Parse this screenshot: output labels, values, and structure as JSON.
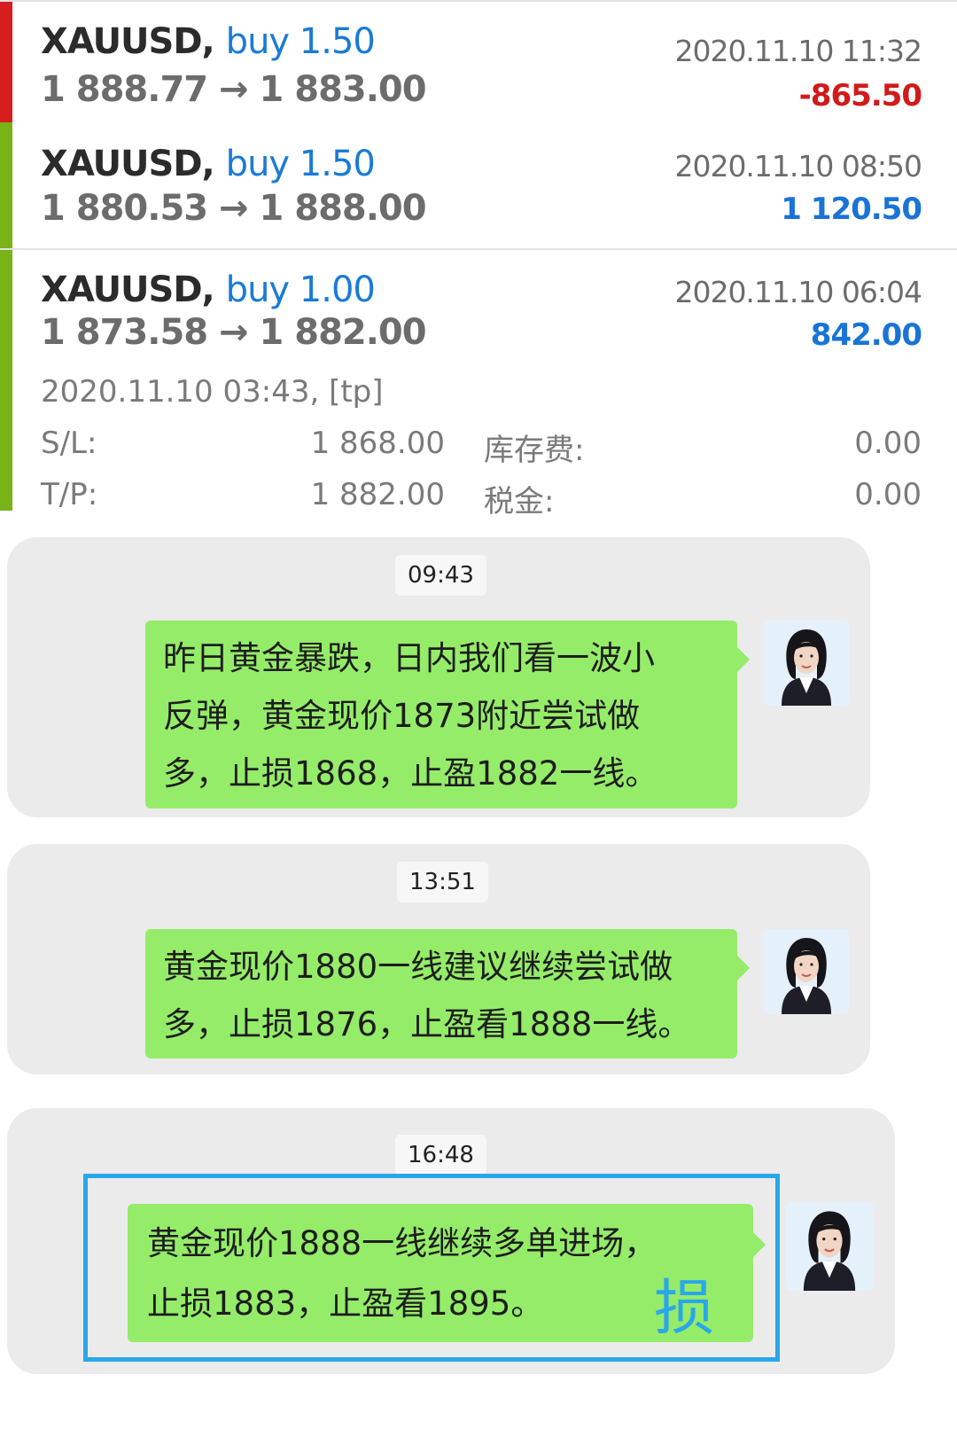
{
  "trades": [
    {
      "symbol": "XAUUSD,",
      "side_volume": "buy 1.50",
      "prices": "1 888.77 → 1 883.00",
      "time": "2020.11.10 11:32",
      "profit": "-865.50",
      "profit_color": "#d11a1a",
      "bar_color": "#d61e1e"
    },
    {
      "symbol": "XAUUSD,",
      "side_volume": "buy 1.50",
      "prices": "1 880.53 → 1 888.00",
      "time": "2020.11.10 08:50",
      "profit": "1 120.50",
      "profit_color": "#1a73d6",
      "bar_color": "#7ab317"
    },
    {
      "symbol": "XAUUSD,",
      "side_volume": "buy 1.00",
      "prices": "1 873.58 → 1 882.00",
      "time": "2020.11.10 06:04",
      "profit": "842.00",
      "profit_color": "#1a73d6",
      "bar_color": "#7ab317",
      "details": {
        "close_info": "2020.11.10 03:43, [tp]",
        "sl_label": "S/L:",
        "sl_value": "1 868.00",
        "swap_label": "库存费:",
        "swap_value": "0.00",
        "tp_label": "T/P:",
        "tp_value": "1 882.00",
        "tax_label": "税金:",
        "tax_value": "0.00"
      }
    }
  ],
  "chats": [
    {
      "time": "09:43",
      "lines": [
        "昨日黄金暴跌，日内我们看一波小",
        "反弹，黄金现价1873附近尝试做",
        "多，止损1868，止盈1882一线。"
      ]
    },
    {
      "time": "13:51",
      "lines": [
        "黄金现价1880一线建议继续尝试做",
        "多，止损1876，止盈看1888一线。"
      ]
    },
    {
      "time": "16:48",
      "lines": [
        "黄金现价1888一线继续多单进场，",
        "止损1883，止盈看1895。"
      ],
      "watermark": "损"
    }
  ],
  "colors": {
    "bubble": "#95ec69",
    "card": "#ebebeb",
    "highlight": "#2aa6ea"
  },
  "icons": {
    "avatar": "user-avatar-photo"
  }
}
